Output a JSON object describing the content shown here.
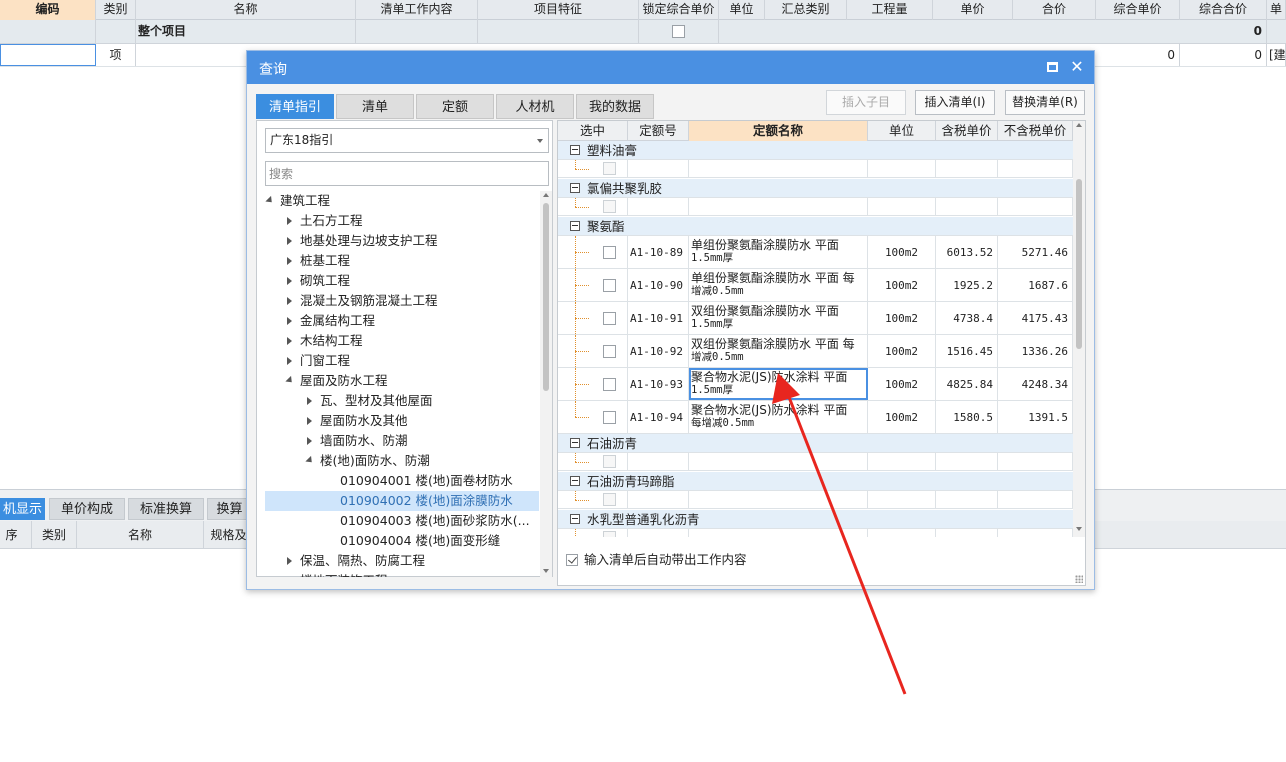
{
  "bg_grid": {
    "headers": [
      "编码",
      "类别",
      "名称",
      "清单工作内容",
      "项目特征",
      "锁定综合单价",
      "单位",
      "汇总类别",
      "工程量",
      "单价",
      "合价",
      "综合单价",
      "综合合价",
      "单"
    ],
    "row1": {
      "name": "整个项目",
      "total": "0"
    },
    "row2": {
      "type": "项",
      "val1": "0",
      "val2": "0",
      "extra": "[建"
    }
  },
  "bottom_panel": {
    "tabs": [
      "机显示",
      "单价构成",
      "标准换算",
      "换算"
    ],
    "headers": [
      "序",
      "类别",
      "名称",
      "规格及"
    ]
  },
  "dialog": {
    "title": "查询",
    "tabs": [
      "清单指引",
      "清单",
      "定额",
      "人材机",
      "我的数据"
    ],
    "buttons": {
      "insert_child": "插入子目",
      "insert_list": "插入清单(I)",
      "replace_list": "替换清单(R)"
    },
    "guide_select": "广东18指引",
    "search_placeholder": "搜索",
    "tree": [
      {
        "label": "建筑工程",
        "level": 0,
        "icon": "expanded"
      },
      {
        "label": "土石方工程",
        "level": 1,
        "icon": "collapsed"
      },
      {
        "label": "地基处理与边坡支护工程",
        "level": 1,
        "icon": "collapsed"
      },
      {
        "label": "桩基工程",
        "level": 1,
        "icon": "collapsed"
      },
      {
        "label": "砌筑工程",
        "level": 1,
        "icon": "collapsed"
      },
      {
        "label": "混凝土及钢筋混凝土工程",
        "level": 1,
        "icon": "collapsed"
      },
      {
        "label": "金属结构工程",
        "level": 1,
        "icon": "collapsed"
      },
      {
        "label": "木结构工程",
        "level": 1,
        "icon": "collapsed"
      },
      {
        "label": "门窗工程",
        "level": 1,
        "icon": "collapsed"
      },
      {
        "label": "屋面及防水工程",
        "level": 1,
        "icon": "expanded"
      },
      {
        "label": "瓦、型材及其他屋面",
        "level": 2,
        "icon": "collapsed"
      },
      {
        "label": "屋面防水及其他",
        "level": 2,
        "icon": "collapsed"
      },
      {
        "label": "墙面防水、防潮",
        "level": 2,
        "icon": "collapsed"
      },
      {
        "label": "楼(地)面防水、防潮",
        "level": 2,
        "icon": "expanded"
      },
      {
        "label": "010904001  楼(地)面卷材防水",
        "level": 3,
        "icon": "none"
      },
      {
        "label": "010904002  楼(地)面涂膜防水",
        "level": 3,
        "icon": "none",
        "selected": true
      },
      {
        "label": "010904003  楼(地)面砂浆防水(...",
        "level": 3,
        "icon": "none"
      },
      {
        "label": "010904004  楼(地)面变形缝",
        "level": 3,
        "icon": "none"
      },
      {
        "label": "保温、隔热、防腐工程",
        "level": 1,
        "icon": "collapsed"
      },
      {
        "label": "楼地面装饰工程",
        "level": 1,
        "icon": "collapsed"
      }
    ],
    "grid_headers": [
      "选中",
      "定额号",
      "定额名称",
      "单位",
      "含税单价",
      "不含税单价"
    ],
    "groups": [
      {
        "name": "塑料油膏",
        "rows": []
      },
      {
        "name": "氯偏共聚乳胶",
        "rows": []
      },
      {
        "name": "聚氨酯",
        "rows": [
          {
            "code": "A1-10-89",
            "name": "单组份聚氨酯涂膜防水 平面",
            "name2": "1.5mm厚",
            "unit": "100m2",
            "tax_price": "6013.52",
            "notax_price": "5271.46"
          },
          {
            "code": "A1-10-90",
            "name": "单组份聚氨酯涂膜防水 平面 每",
            "name2": "增减0.5mm",
            "unit": "100m2",
            "tax_price": "1925.2",
            "notax_price": "1687.6"
          },
          {
            "code": "A1-10-91",
            "name": "双组份聚氨酯涂膜防水 平面",
            "name2": "1.5mm厚",
            "unit": "100m2",
            "tax_price": "4738.4",
            "notax_price": "4175.43"
          },
          {
            "code": "A1-10-92",
            "name": "双组份聚氨酯涂膜防水 平面 每",
            "name2": "增减0.5mm",
            "unit": "100m2",
            "tax_price": "1516.45",
            "notax_price": "1336.26"
          },
          {
            "code": "A1-10-93",
            "name": "聚合物水泥(JS)防水涂料 平面",
            "name2": "1.5mm厚",
            "unit": "100m2",
            "tax_price": "4825.84",
            "notax_price": "4248.34"
          },
          {
            "code": "A1-10-94",
            "name": "聚合物水泥(JS)防水涂料 平面",
            "name2": "每增减0.5mm",
            "unit": "100m2",
            "tax_price": "1580.5",
            "notax_price": "1391.5"
          }
        ]
      },
      {
        "name": "石油沥青",
        "rows": []
      },
      {
        "name": "石油沥青玛蹄脂",
        "rows": []
      },
      {
        "name": "水乳型普通乳化沥青",
        "rows": []
      }
    ],
    "auto_option": "输入清单后自动带出工作内容"
  },
  "colors": {
    "accent": "#4a90e2",
    "annotation": "#e8261f"
  }
}
